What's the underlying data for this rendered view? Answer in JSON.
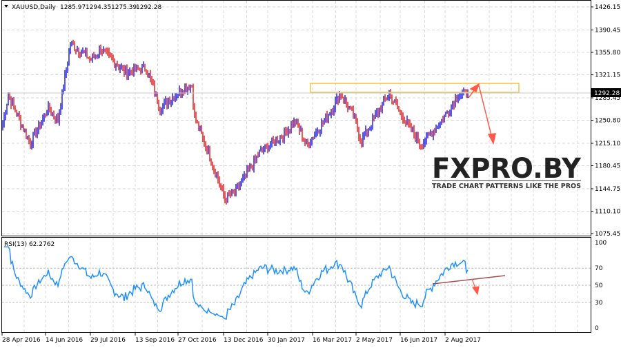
{
  "header": {
    "symbol_label": "XAUUSD,Daily",
    "open": "1285.97",
    "high": "1294.35",
    "low": "1275.39",
    "close": "1292.28"
  },
  "colors": {
    "bull": "#0000e0",
    "bear": "#e00000",
    "rsi": "#1e90ff",
    "grid": "#d8d8d8",
    "annotation": "#ff5a4a",
    "zone": "#f5c24a",
    "trendline": "#a05050"
  },
  "watermark": {
    "brand": "FXPRO.BY",
    "tagline": "TRADE CHART PATTERNS LIKE THE PROS"
  },
  "chart_data": [
    {
      "type": "ohlc",
      "title": "XAUUSD,Daily",
      "ylim": [
        1075.45,
        1426.15
      ],
      "y_ticks": [
        "1426.15",
        "1390.45",
        "1355.80",
        "1321.15",
        "1285.45",
        "1250.80",
        "1215.10",
        "1180.45",
        "1144.75",
        "1110.10",
        "1075.45"
      ],
      "current_price_label": "1292.28",
      "bar_count": 338,
      "key_closes": [
        [
          0,
          1245
        ],
        [
          4,
          1290
        ],
        [
          20,
          1215
        ],
        [
          33,
          1270
        ],
        [
          40,
          1250
        ],
        [
          49,
          1370
        ],
        [
          64,
          1345
        ],
        [
          71,
          1360
        ],
        [
          89,
          1325
        ],
        [
          104,
          1332
        ],
        [
          114,
          1270
        ],
        [
          131,
          1300
        ],
        [
          137,
          1305
        ],
        [
          139,
          1255
        ],
        [
          149,
          1200
        ],
        [
          161,
          1130
        ],
        [
          169,
          1140
        ],
        [
          186,
          1200
        ],
        [
          203,
          1228
        ],
        [
          212,
          1250
        ],
        [
          220,
          1212
        ],
        [
          233,
          1250
        ],
        [
          245,
          1292
        ],
        [
          253,
          1262
        ],
        [
          260,
          1218
        ],
        [
          268,
          1250
        ],
        [
          280,
          1292
        ],
        [
          288,
          1262
        ],
        [
          303,
          1212
        ],
        [
          318,
          1250
        ],
        [
          330,
          1290
        ],
        [
          337,
          1292
        ]
      ],
      "x_ticks": [
        "28 Apr 2016",
        "14 Jun 2016",
        "29 Jul 2016",
        "13 Sep 2016",
        "27 Oct 2016",
        "13 Dec 2016",
        "30 Jan 2017",
        "16 Mar 2017",
        "2 May 2017",
        "16 Jun 2017",
        "2 Aug 2017"
      ],
      "resistance_zone": [
        1292,
        1305
      ]
    },
    {
      "type": "line",
      "title": "RSI(13)",
      "label": "RSI(13) 62.2762",
      "period": 13,
      "last_value": 62.2762,
      "ylim": [
        0,
        100
      ],
      "y_ticks": [
        "100",
        "70",
        "50",
        "30",
        "0"
      ],
      "levels": [
        70,
        50,
        30
      ]
    }
  ]
}
